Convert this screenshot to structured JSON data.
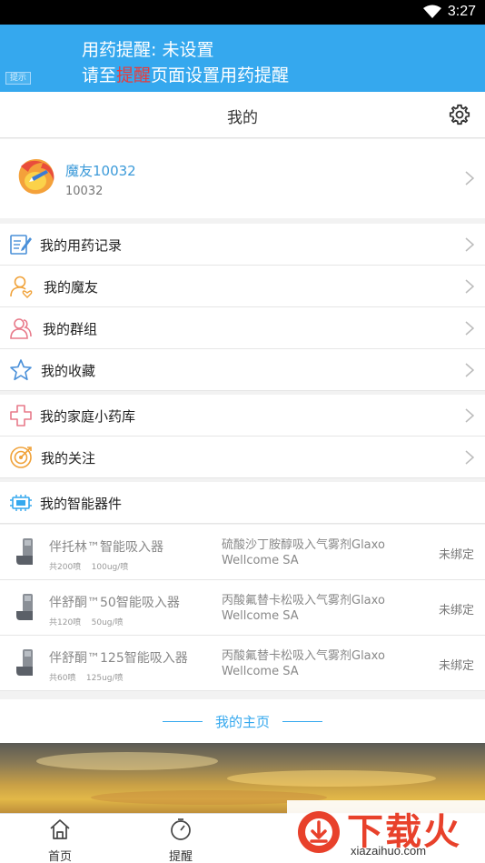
{
  "status_bar": {
    "time": "3:27"
  },
  "banner": {
    "tag": "提示",
    "line1": "用药提醒: 未设置",
    "line2_prefix": "请至",
    "line2_highlight": "提醒",
    "line2_suffix": "页面设置用药提醒"
  },
  "header": {
    "title": "我的"
  },
  "profile": {
    "name": "魔友10032",
    "id": "10032"
  },
  "menu": {
    "records": "我的用药记录",
    "friends": "我的魔友",
    "groups": "我的群组",
    "favorites": "我的收藏",
    "pharmacy": "我的家庭小药库",
    "follows": "我的关注",
    "devices": "我的智能器件"
  },
  "devices": [
    {
      "name": "伴托林™智能吸入器",
      "dose_count": "共200喷",
      "dose": "100ug/喷",
      "drug": "硫酸沙丁胺醇吸入气雾剂Glaxo Wellcome SA",
      "status": "未绑定"
    },
    {
      "name": "伴舒酮™50智能吸入器",
      "dose_count": "共120喷",
      "dose": "50ug/喷",
      "drug": "丙酸氟替卡松吸入气雾剂Glaxo Wellcome SA",
      "status": "未绑定"
    },
    {
      "name": "伴舒酮™125智能吸入器",
      "dose_count": "共60喷",
      "dose": "125ug/喷",
      "drug": "丙酸氟替卡松吸入气雾剂Glaxo Wellcome SA",
      "status": "未绑定"
    }
  ],
  "homepage": {
    "label": "我的主页"
  },
  "tabs": {
    "home": "首页",
    "remind": "提醒"
  },
  "watermark": {
    "brand": "下载火",
    "site": "xiazaihuo.com"
  },
  "colors": {
    "accent": "#35a8ee",
    "highlight": "#e93a3a",
    "name": "#3b9ad9"
  }
}
